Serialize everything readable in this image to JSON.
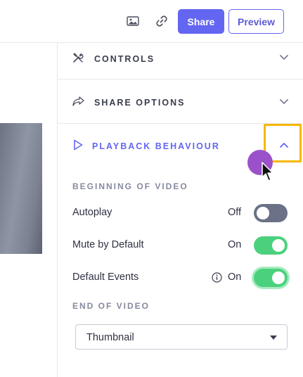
{
  "toolbar": {
    "share_label": "Share",
    "preview_label": "Preview",
    "icons": [
      "image-icon",
      "link-icon"
    ]
  },
  "panel": {
    "sections": {
      "controls": {
        "title": "CONTROLS",
        "icon": "tools-icon",
        "expanded": false
      },
      "share_options": {
        "title": "SHARE OPTIONS",
        "icon": "share-arrow-icon",
        "expanded": false
      },
      "playback": {
        "title": "PLAYBACK BEHAVIOUR",
        "icon": "play-icon",
        "expanded": true
      }
    },
    "beginning_heading": "BEGINNING OF VIDEO",
    "rows": {
      "autoplay": {
        "label": "Autoplay",
        "state": "Off",
        "on": false
      },
      "mute": {
        "label": "Mute by Default",
        "state": "On",
        "on": true
      },
      "events": {
        "label": "Default Events",
        "state": "On",
        "on": true,
        "info_icon": "info-icon"
      }
    },
    "end_heading": "END OF VIDEO",
    "end_select": {
      "value": "Thumbnail"
    }
  },
  "colors": {
    "accent": "#6366f1",
    "toggle_on": "#4bd17d",
    "toggle_off": "#6b7287",
    "highlight": "#f5b800",
    "click_marker": "#9b51c9"
  }
}
